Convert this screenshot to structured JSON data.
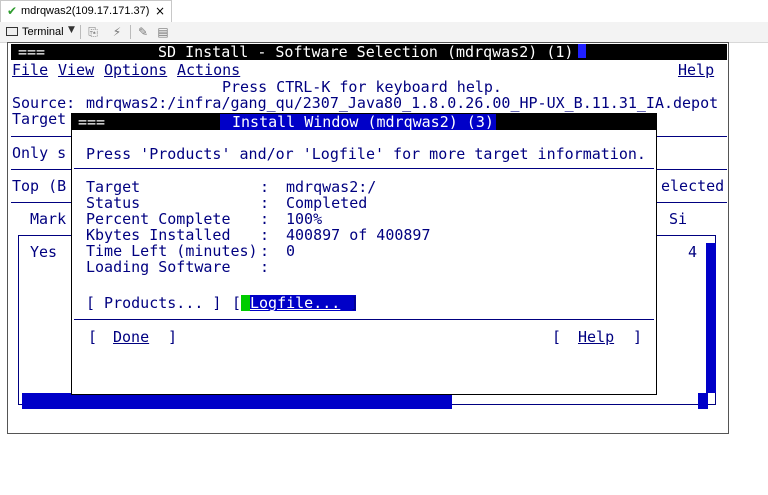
{
  "tab": {
    "check_icon": "check-icon",
    "title": "mdrqwas2(109.17.171.37)",
    "close": "×"
  },
  "toolbar": {
    "terminal_label": "Terminal"
  },
  "terminal": {
    "title_dashes": "===",
    "title": "SD Install - Software Selection (mdrqwas2) (1)",
    "menus": [
      "File",
      "View",
      "Options",
      "Actions"
    ],
    "help_menu": "Help",
    "hint": "Press CTRL-K for keyboard help.",
    "source_label": "Source:",
    "source_value": "mdrqwas2:/infra/gang_qu/2307_Java80_1.8.0.26.00_HP-UX_B.11.31_IA.depot",
    "target_label": "Target",
    "only_s": "Only s",
    "top_label": "Top (B",
    "selected_fragment": "elected",
    "mark_label": "Mark",
    "si_label": "Si",
    "row_yes": "Yes",
    "row_num": "4"
  },
  "install_window": {
    "title_dashes": "===",
    "title": "Install Window (mdrqwas2) (3)",
    "info": "Press 'Products' and/or 'Logfile' for more target information.",
    "fields": [
      {
        "label": "Target",
        "sep": ":",
        "value": "mdrqwas2:/"
      },
      {
        "label": "Status",
        "sep": ":",
        "value": "Completed"
      },
      {
        "label": "Percent Complete",
        "sep": ":",
        "value": "100%"
      },
      {
        "label": "Kbytes Installed",
        "sep": ":",
        "value": "400897 of 400897"
      },
      {
        "label": "Time Left (minutes)",
        "sep": ":",
        "value": "0"
      },
      {
        "label": "Loading Software",
        "sep": ":",
        "value": ""
      }
    ],
    "products_button": "[ Products... ]",
    "logfile_open": "[",
    "logfile_label": "Logfile...",
    "logfile_close": "]",
    "done_open": "[",
    "done_label": "Done",
    "done_close": "]",
    "help_open": "[",
    "help_label": "Help",
    "help_close": "]"
  }
}
